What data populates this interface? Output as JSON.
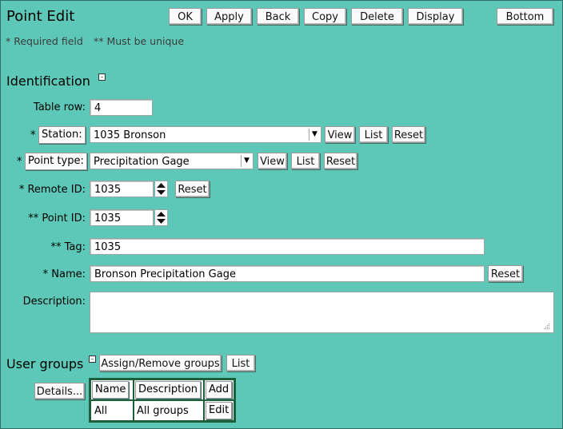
{
  "header": {
    "title": "Point Edit",
    "buttons": {
      "ok": "OK",
      "apply": "Apply",
      "back": "Back",
      "copy": "Copy",
      "delete": "Delete",
      "display": "Display",
      "bottom": "Bottom"
    },
    "note_required": "* Required field",
    "note_unique": "** Must be unique"
  },
  "identification": {
    "heading": "Identification",
    "table_row": {
      "label": "Table row:",
      "value": "4"
    },
    "station": {
      "marker": "*",
      "label": "Station:",
      "value": "1035 Bronson",
      "view": "View",
      "list": "List",
      "reset": "Reset"
    },
    "point_type": {
      "marker": "*",
      "label": "Point type:",
      "value": "Precipitation Gage",
      "view": "View",
      "list": "List",
      "reset": "Reset"
    },
    "remote_id": {
      "label": "* Remote ID:",
      "value": "1035",
      "reset": "Reset"
    },
    "point_id": {
      "label": "** Point ID:",
      "value": "1035"
    },
    "tag": {
      "label": "** Tag:",
      "value": "1035"
    },
    "name": {
      "label": "* Name:",
      "value": "Bronson Precipitation Gage",
      "reset": "Reset"
    },
    "description": {
      "label": "Description:",
      "value": ""
    }
  },
  "user_groups": {
    "heading": "User groups",
    "assign_button": "Assign/Remove groups",
    "list_button": "List",
    "details_button": "Details...",
    "columns": {
      "name": "Name",
      "description": "Description",
      "add": "Add"
    },
    "rows": [
      {
        "name": "All",
        "description": "All groups",
        "action": "Edit"
      }
    ]
  }
}
